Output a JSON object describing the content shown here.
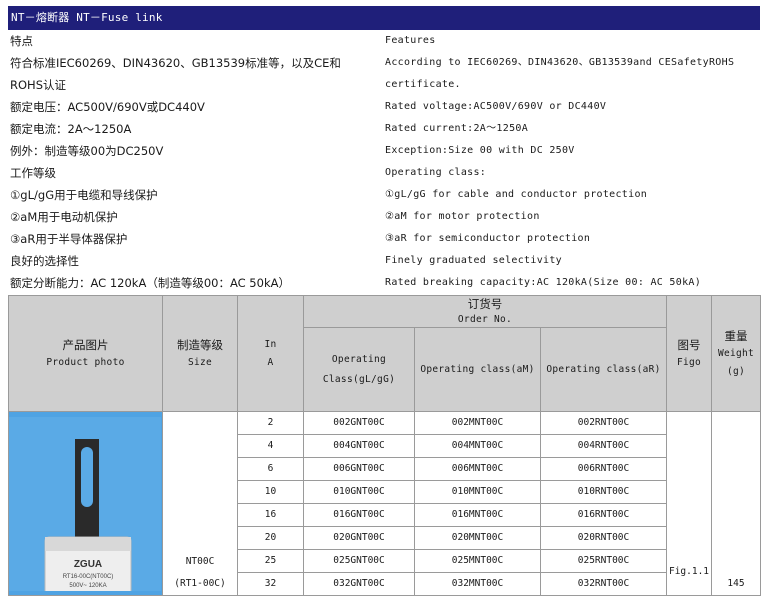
{
  "title": "NT－熔断器 NT－Fuse link",
  "specs": [
    {
      "zh": "特点",
      "en": "Features"
    },
    {
      "zh": "符合标准IEC60269、DIN43620、GB13539标准等，以及CE和",
      "en": "According to IEC60269、DIN43620、GB13539and CESafetyROHS"
    },
    {
      "zh": "ROHS认证",
      "en": "certificate."
    },
    {
      "zh": "额定电压：AC500V/690V或DC440V",
      "en": "Rated voltage:AC500V/690V or DC440V"
    },
    {
      "zh": "额定电流：2A～1250A",
      "en": "Rated current:2A～1250A"
    },
    {
      "zh": "例外：制造等级00为DC250V",
      "en": "Exception:Size 00 with DC 250V"
    },
    {
      "zh": "工作等级",
      "en": "Operating class:"
    },
    {
      "zh": "①gL/gG用于电缆和导线保护",
      "en": "①gL/gG for cable and conductor protection"
    },
    {
      "zh": "②aM用于电动机保护",
      "en": "②aM for motor protection"
    },
    {
      "zh": "③aR用于半导体器保护",
      "en": "③aR for semiconductor protection"
    },
    {
      "zh": "良好的选择性",
      "en": "Finely graduated selectivity"
    },
    {
      "zh": "额定分断能力：AC 120kA（制造等级00：AC 50kA）",
      "en": "Rated breaking capacity:AC 120kA(Size 00: AC 50kA)"
    }
  ],
  "table": {
    "headers": {
      "photo_zh": "产品图片",
      "photo_en": "Product photo",
      "size_zh": "制造等级",
      "size_en": "Size",
      "in_1": "In",
      "in_2": "A",
      "order_zh": "订货号",
      "order_en": "Order No.",
      "gl_1": "Operating",
      "gl_2": "Class(gL/gG)",
      "am": "Operating class(aM)",
      "ar": "Operating class(aR)",
      "figo_zh": "图号",
      "figo_en": "Figo",
      "weight_zh": "重量",
      "weight_en": "Weight",
      "weight_unit": "(g)"
    },
    "size_1": "NT00C",
    "size_2": "(RT1-00C)",
    "figo": "Fig.1.1",
    "weight": "145",
    "product_label_brand": "ZGUA",
    "product_label_model": "RT16-00C(NT00C)",
    "product_label_rating": "500V~ 120KA",
    "rows": [
      {
        "in": "2",
        "gl": "002GNT00C",
        "am": "002MNT00C",
        "ar": "002RNT00C"
      },
      {
        "in": "4",
        "gl": "004GNT00C",
        "am": "004MNT00C",
        "ar": "004RNT00C"
      },
      {
        "in": "6",
        "gl": "006GNT00C",
        "am": "006MNT00C",
        "ar": "006RNT00C"
      },
      {
        "in": "10",
        "gl": "010GNT00C",
        "am": "010MNT00C",
        "ar": "010RNT00C"
      },
      {
        "in": "16",
        "gl": "016GNT00C",
        "am": "016MNT00C",
        "ar": "016RNT00C"
      },
      {
        "in": "20",
        "gl": "020GNT00C",
        "am": "020MNT00C",
        "ar": "020RNT00C"
      },
      {
        "in": "25",
        "gl": "025GNT00C",
        "am": "025MNT00C",
        "ar": "025RNT00C"
      },
      {
        "in": "32",
        "gl": "032GNT00C",
        "am": "032MNT00C",
        "ar": "032RNT00C"
      }
    ]
  }
}
